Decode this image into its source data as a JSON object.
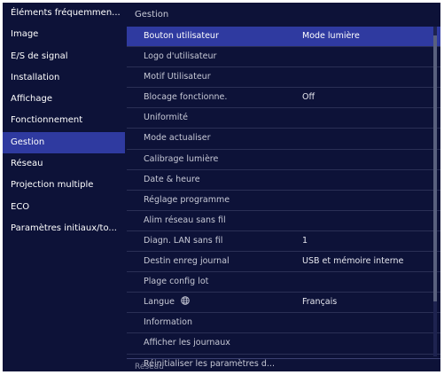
{
  "sidebar": {
    "items": [
      {
        "label": "Éléments fréquemmen..."
      },
      {
        "label": "Image"
      },
      {
        "label": "E/S de signal"
      },
      {
        "label": "Installation"
      },
      {
        "label": "Affichage"
      },
      {
        "label": "Fonctionnement"
      },
      {
        "label": "Gestion"
      },
      {
        "label": "Réseau"
      },
      {
        "label": "Projection multiple"
      },
      {
        "label": "ECO"
      },
      {
        "label": "Paramètres initiaux/to..."
      }
    ],
    "active_index": 6
  },
  "main": {
    "section_title": "Gestion",
    "rows": [
      {
        "label": "Bouton utilisateur",
        "value": "Mode lumière"
      },
      {
        "label": "Logo d'utilisateur",
        "value": ""
      },
      {
        "label": "Motif Utilisateur",
        "value": ""
      },
      {
        "label": "Blocage fonctionne.",
        "value": "Off"
      },
      {
        "label": "Uniformité",
        "value": ""
      },
      {
        "label": "Mode actualiser",
        "value": ""
      },
      {
        "label": "Calibrage lumière",
        "value": ""
      },
      {
        "label": "Date & heure",
        "value": ""
      },
      {
        "label": "Réglage programme",
        "value": ""
      },
      {
        "label": "Alim réseau sans fil",
        "value": ""
      },
      {
        "label": "Diagn. LAN sans fil",
        "value": "1"
      },
      {
        "label": "Destin enreg journal",
        "value": "USB et mémoire interne"
      },
      {
        "label": "Plage config lot",
        "value": ""
      },
      {
        "label": "Langue",
        "value": "Français",
        "icon": "globe-icon"
      },
      {
        "label": "Information",
        "value": ""
      },
      {
        "label": "Afficher les journaux",
        "value": ""
      },
      {
        "label": "Réinitialiser les paramètres d...",
        "value": ""
      }
    ],
    "selected_index": 0,
    "footer_label": "Réseau"
  },
  "colors": {
    "background": "#0d1238",
    "highlight": "#2f3aa0",
    "text": "#c7c9d6"
  }
}
